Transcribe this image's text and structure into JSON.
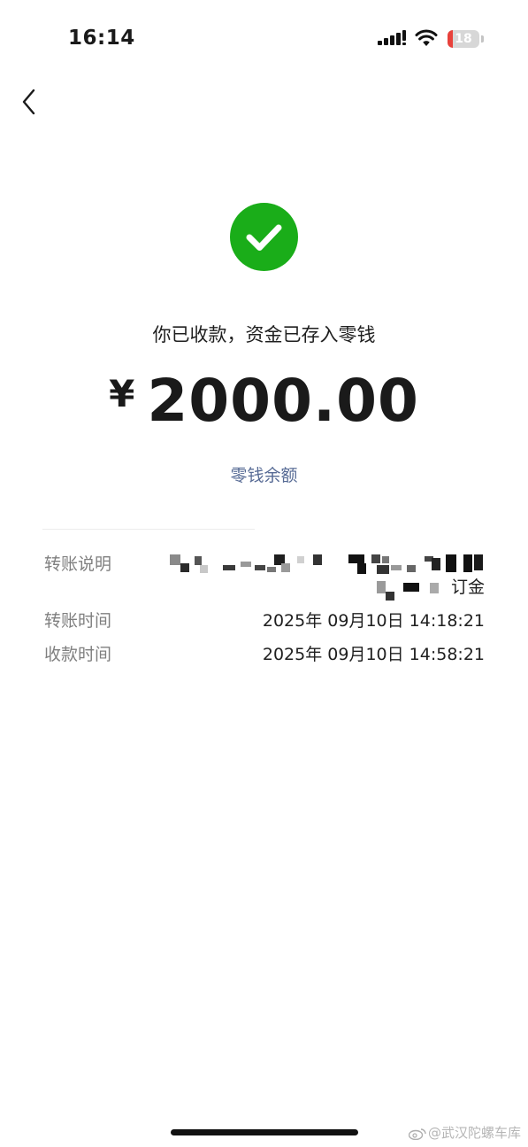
{
  "status_bar": {
    "time": "16:14",
    "battery_level": "18",
    "battery_color": "#e8413b",
    "icons": [
      "signal-icon",
      "wifi-icon",
      "battery-icon"
    ]
  },
  "nav": {
    "back_icon": "chevron-left-icon"
  },
  "receipt": {
    "status_icon": "check-circle-icon",
    "status_color": "#1aad19",
    "headline": "你已收款，资金已存入零钱",
    "currency_symbol": "¥",
    "amount": "2000.00",
    "balance_link": "零钱余额",
    "link_color": "#576b95"
  },
  "details": {
    "remark": {
      "label": "转账说明",
      "value": "订金"
    },
    "transfer_time": {
      "label": "转账时间",
      "value": "2025年 09月10日 14:18:21"
    },
    "receive_time": {
      "label": "收款时间",
      "value": "2025年 09月10日 14:58:21"
    }
  },
  "watermark": {
    "icon": "weibo-icon",
    "text": "@武汉陀螺车库"
  }
}
